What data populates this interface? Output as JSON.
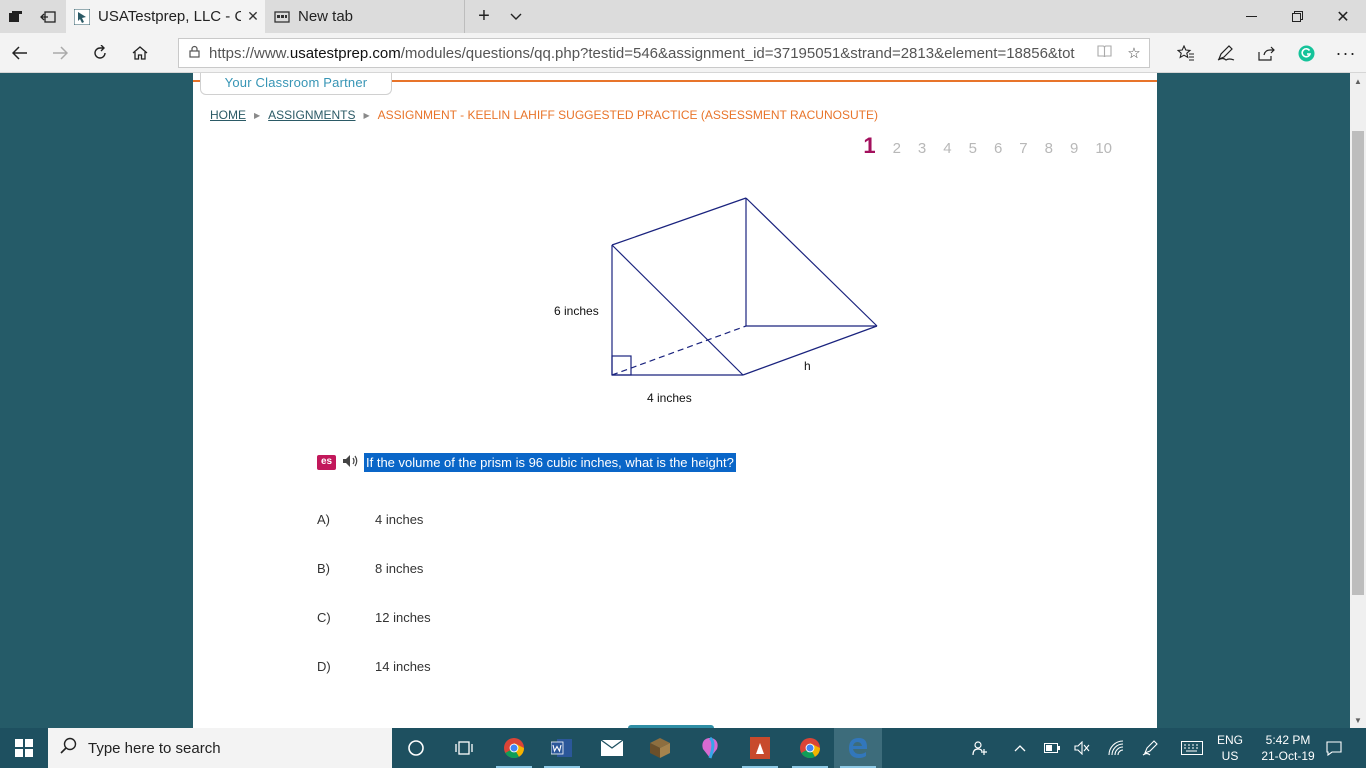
{
  "browser": {
    "tabs": [
      {
        "title": "USATestprep, LLC - C",
        "active": true
      },
      {
        "title": "New tab",
        "active": false
      }
    ],
    "url_prefix": "https://www.",
    "url_domain": "usatestprep.com",
    "url_path": "/modules/questions/qq.php?testid=546&assignment_id=37195051&strand=2813&element=18856&tot"
  },
  "page": {
    "partner_tagline": "Your Classroom Partner",
    "breadcrumb": {
      "home": "HOME",
      "assignments": "ASSIGNMENTS",
      "current": "ASSIGNMENT - KEELIN LAHIFF SUGGESTED PRACTICE (ASSESSMENT RACUNOSUTE)"
    },
    "question_numbers": [
      "1",
      "2",
      "3",
      "4",
      "5",
      "6",
      "7",
      "8",
      "9",
      "10"
    ],
    "current_question": "1",
    "figure": {
      "label_height": "6 inches",
      "label_base": "4 inches",
      "label_h": "h"
    },
    "es_badge": "es",
    "question_text": "If the volume of the prism is 96 cubic inches, what is the height?",
    "answers": [
      {
        "letter": "A)",
        "text": "4 inches"
      },
      {
        "letter": "B)",
        "text": "8 inches"
      },
      {
        "letter": "C)",
        "text": "12 inches"
      },
      {
        "letter": "D)",
        "text": "14 inches"
      }
    ]
  },
  "taskbar": {
    "search_placeholder": "Type here to search",
    "lang_top": "ENG",
    "lang_bottom": "US",
    "time": "5:42 PM",
    "date": "21-Oct-19"
  },
  "colors": {
    "desktop_bg": "#255b68",
    "accent_orange": "#e8742a",
    "question_active": "#a3105d",
    "selection_blue": "#0a66c8",
    "figure_lines": "#1a237e"
  }
}
